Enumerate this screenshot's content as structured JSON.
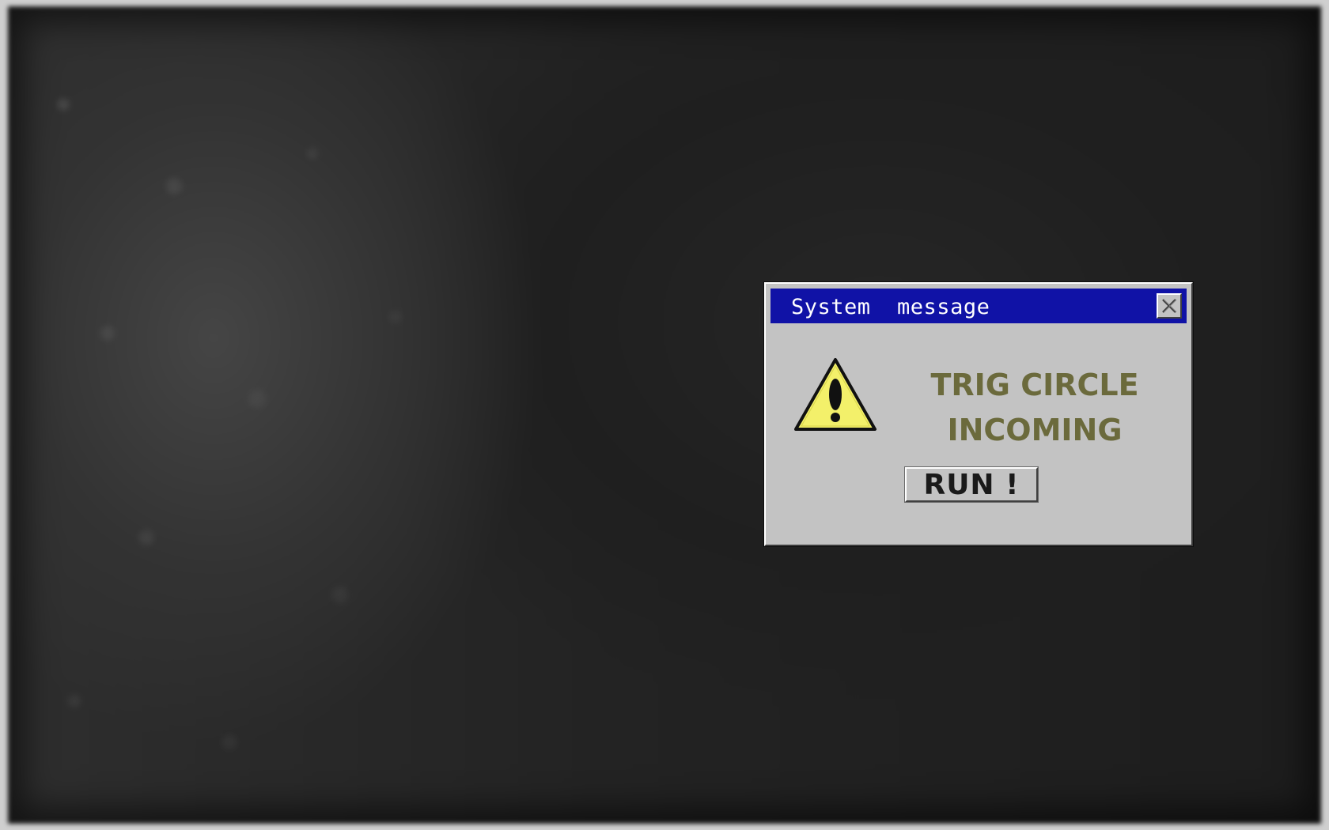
{
  "dialog": {
    "title": "System  message",
    "close_icon": "close-x-icon",
    "warning_icon": "warning-triangle-icon",
    "message_lines": [
      "TRIG CIRCLE",
      "INCOMING"
    ],
    "button_label": "RUN !"
  },
  "colors": {
    "titlebar": "#1012a6",
    "dialog_face": "#c3c3c3",
    "message_text": "#6b6a3c",
    "warning_yellow": "#f3f06a",
    "background": "#262626"
  }
}
